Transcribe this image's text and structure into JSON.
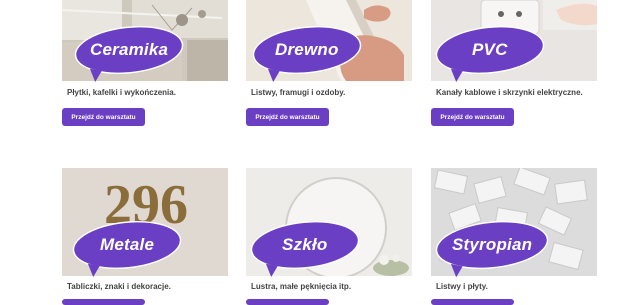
{
  "colors": {
    "accent": "#6a3fc4"
  },
  "cards": [
    {
      "title": "Ceramika",
      "description": "Płytki, kafelki i wykończenia.",
      "button": "Przejdź do warsztatu",
      "image": "white-brick-tiles"
    },
    {
      "title": "Drewno",
      "description": "Listwy, framugi i ozdoby.",
      "button": "Przejdź do warsztatu",
      "image": "hands-on-molding"
    },
    {
      "title": "PVC",
      "description": "Kanały kablowe i skrzynki elektryczne.",
      "button": "Przejdź do warsztatu",
      "image": "wall-socket"
    },
    {
      "title": "Metale",
      "description": "Tabliczki, znaki i dekoracje.",
      "button": "Przejdź do warsztatu",
      "image": "house-number"
    },
    {
      "title": "Szkło",
      "description": "Lustra, małe pęknięcia itp.",
      "button": "Przejdź do warsztatu",
      "image": "round-mirror"
    },
    {
      "title": "Styropian",
      "description": "Listwy i płyty.",
      "button": "Przejdź do warsztatu",
      "image": "foam-blocks"
    }
  ],
  "house_number": "296"
}
